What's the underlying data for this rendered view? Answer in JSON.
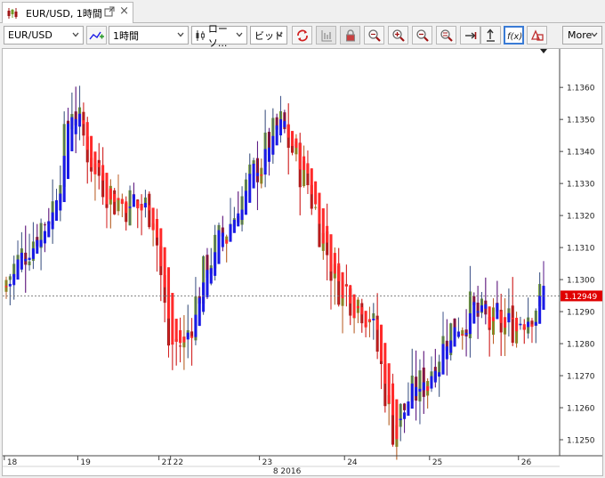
{
  "tab": {
    "title": "EUR/USD, 1時間",
    "close_label": "×"
  },
  "toolbar": {
    "instrument": "EUR/USD",
    "timeframe": "1時間",
    "chart_type": "ローソ...",
    "price_type": "ビッド",
    "more_label": "More"
  },
  "colors": {
    "bull_candle": "#6f9a25",
    "bear_candle": "#a01515",
    "ha_bull": "#1a1ae6",
    "ha_bear": "#ff2a2a",
    "price_tag": "#e00000",
    "accent": "#3a7bd5"
  },
  "chart_data": {
    "type": "candlestick",
    "instrument": "EUR/USD",
    "timeframe": "1時間",
    "current_price_label": "1.12949",
    "current_price": 1.12949,
    "ylim": [
      1.1245,
      1.1372
    ],
    "y_ticks": [
      "1.1360",
      "1.1350",
      "1.1340",
      "1.1330",
      "1.1320",
      "1.1310",
      "1.1300",
      "1.1290",
      "1.1280",
      "1.1270",
      "1.1260",
      "1.1250"
    ],
    "y_tick_values": [
      1.136,
      1.135,
      1.134,
      1.133,
      1.132,
      1.131,
      1.13,
      1.129,
      1.128,
      1.127,
      1.126,
      1.125
    ],
    "x_ticks": [
      "18",
      "19",
      "21",
      "22",
      "23",
      "24",
      "25",
      "26"
    ],
    "x_tick_bars": [
      0,
      19,
      40,
      43,
      66,
      88,
      110,
      133
    ],
    "x_axis_label": "8 2016",
    "x_axis_label_bar": 69,
    "bar_count": 140,
    "keypoints": [
      {
        "i": 0,
        "p": 1.13
      },
      {
        "i": 6,
        "p": 1.1311
      },
      {
        "i": 12,
        "p": 1.1323
      },
      {
        "i": 17,
        "p": 1.1355
      },
      {
        "i": 22,
        "p": 1.1337
      },
      {
        "i": 28,
        "p": 1.1325
      },
      {
        "i": 38,
        "p": 1.1322
      },
      {
        "i": 42,
        "p": 1.128
      },
      {
        "i": 46,
        "p": 1.128
      },
      {
        "i": 52,
        "p": 1.1305
      },
      {
        "i": 58,
        "p": 1.1318
      },
      {
        "i": 66,
        "p": 1.1338
      },
      {
        "i": 71,
        "p": 1.1348
      },
      {
        "i": 78,
        "p": 1.133
      },
      {
        "i": 85,
        "p": 1.13
      },
      {
        "i": 94,
        "p": 1.129
      },
      {
        "i": 100,
        "p": 1.1254
      },
      {
        "i": 104,
        "p": 1.1262
      },
      {
        "i": 108,
        "p": 1.1268
      },
      {
        "i": 114,
        "p": 1.1283
      },
      {
        "i": 120,
        "p": 1.129
      },
      {
        "i": 126,
        "p": 1.1285
      },
      {
        "i": 132,
        "p": 1.1287
      },
      {
        "i": 139,
        "p": 1.1295
      }
    ]
  }
}
